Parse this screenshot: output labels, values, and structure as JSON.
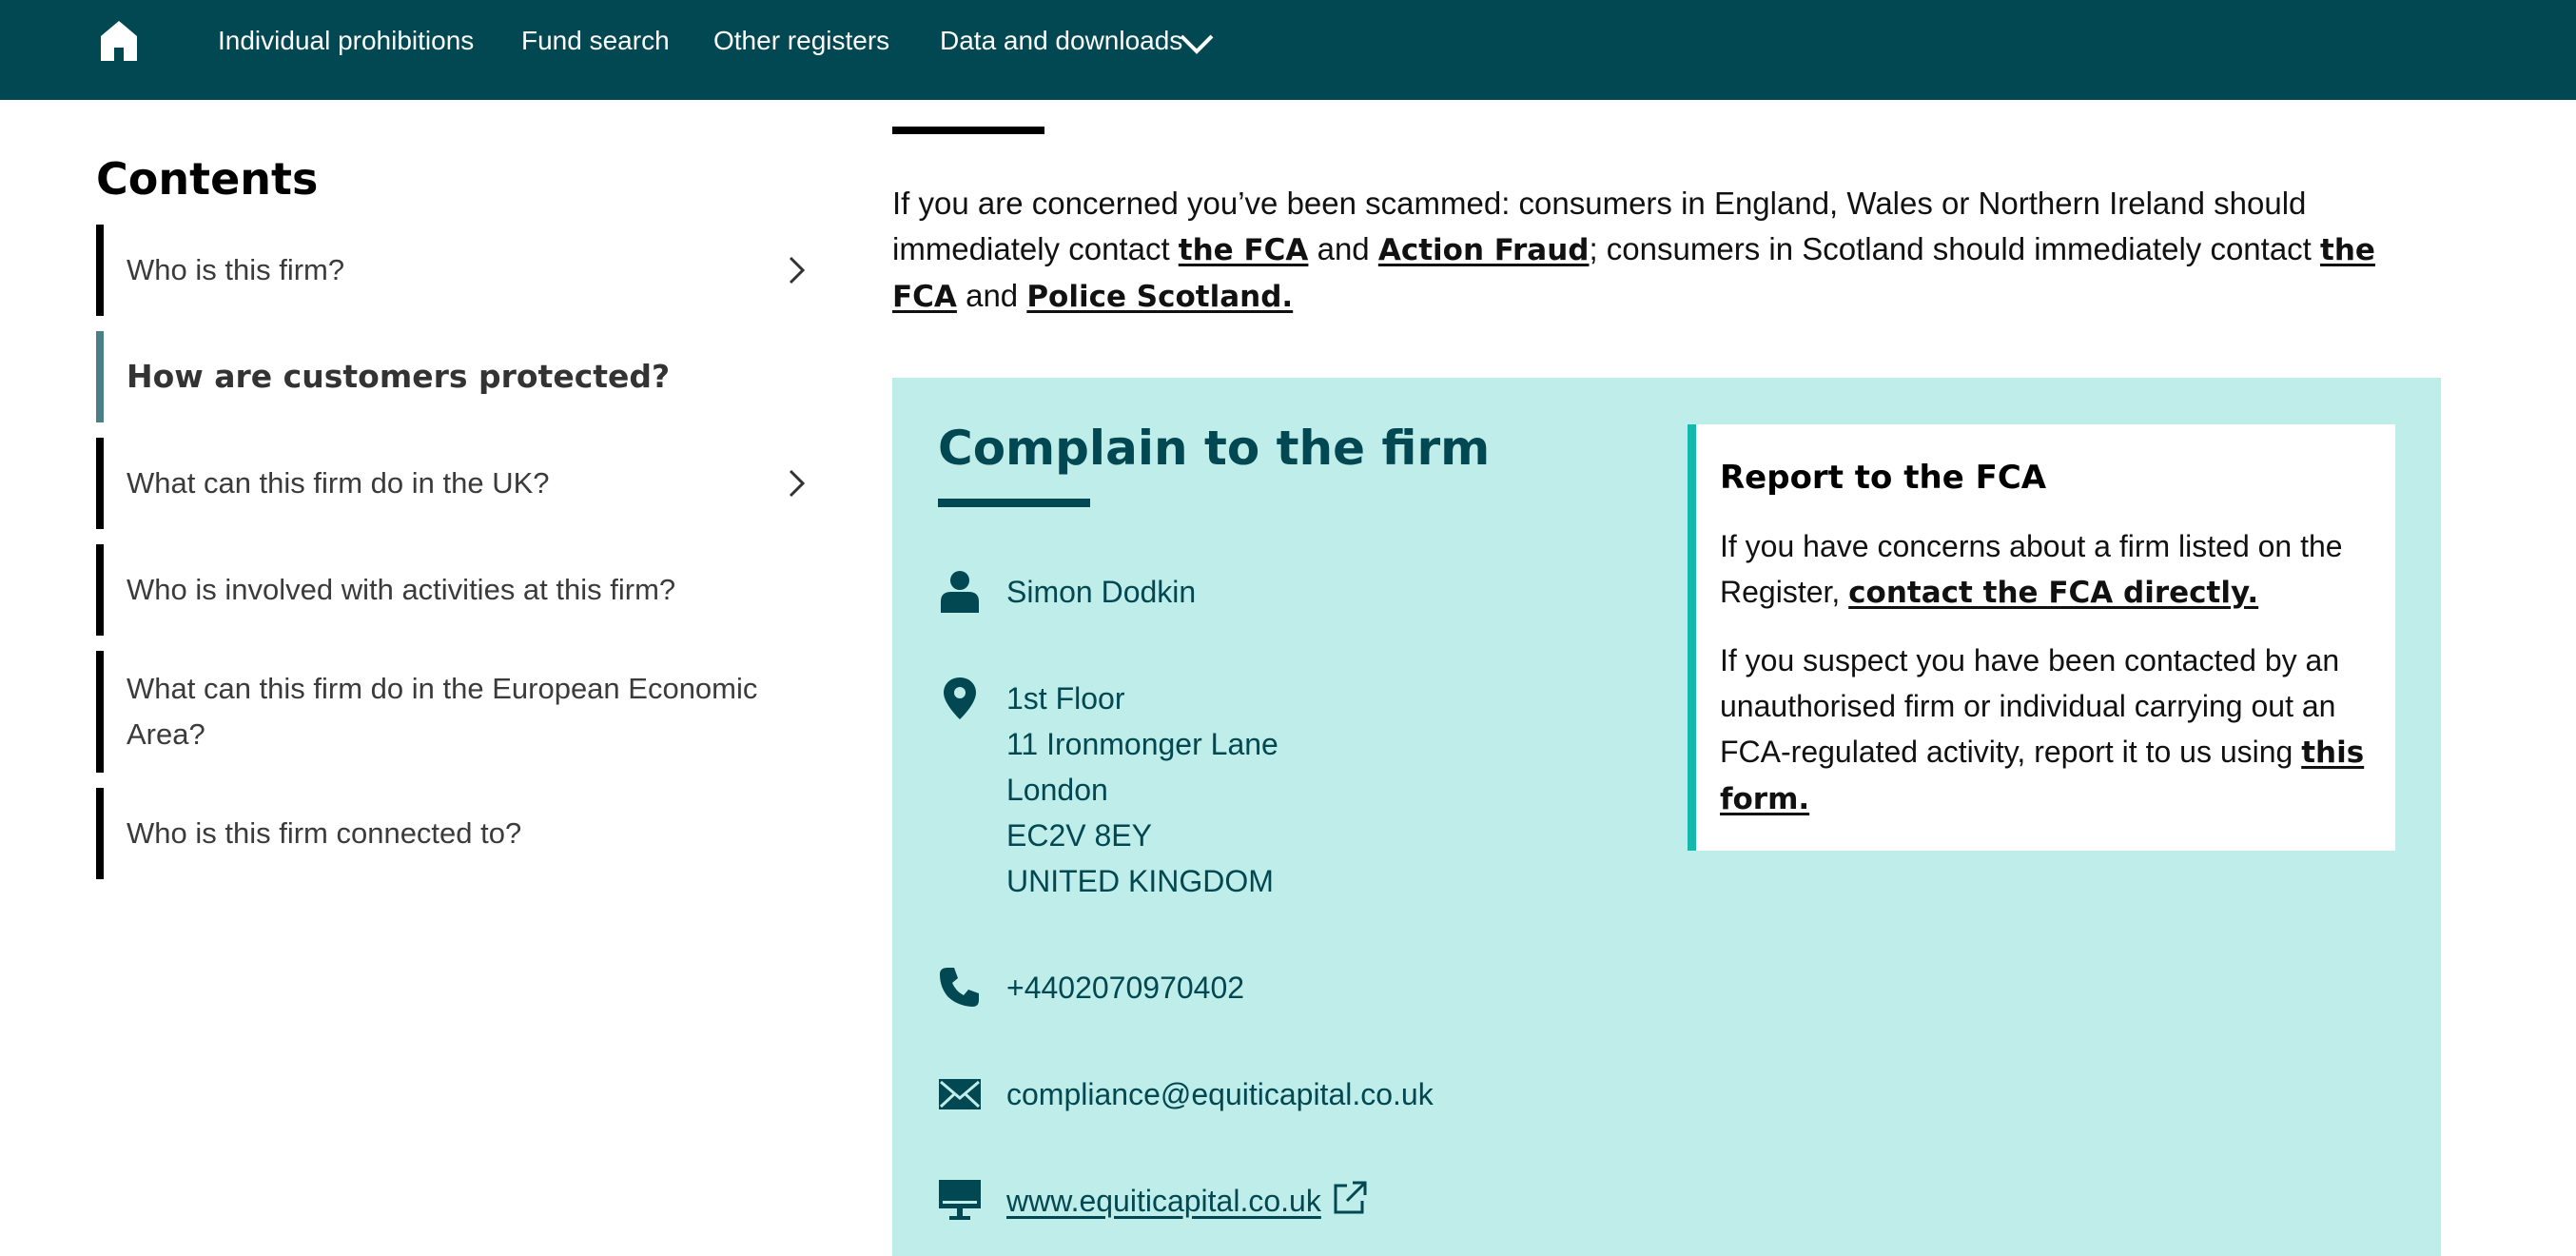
{
  "nav": {
    "home_icon": "home-icon",
    "links": [
      "Individual prohibitions",
      "Fund search",
      "Other registers",
      "Data and downloads"
    ],
    "dropdown_icon": "chevron-down-icon",
    "background": "#024852"
  },
  "sidebar": {
    "title": "Contents",
    "items": [
      {
        "label": "Who is this firm?",
        "expandable": true,
        "active": false
      },
      {
        "label": "How are customers protected?",
        "expandable": false,
        "active": true
      },
      {
        "label": "What can this firm do in the UK?",
        "expandable": true,
        "active": false
      },
      {
        "label": "Who is involved with activities at this firm?",
        "expandable": false,
        "active": false
      },
      {
        "label": "What can this firm do in the European Economic Area?",
        "expandable": false,
        "active": false
      },
      {
        "label": "Who is this firm connected to?",
        "expandable": false,
        "active": false
      }
    ],
    "active_color": "#4b7f87"
  },
  "scam_notice": {
    "part1": "If you are concerned you’ve been scammed: consumers in England, Wales or Northern Ireland should immediately contact ",
    "link1": "the FCA",
    "and1": " and ",
    "link2": "Action Fraud",
    "part2": "; consumers in Scotland should immediately contact ",
    "link3": "the FCA",
    "and2": " and ",
    "link4": "Police Scotland."
  },
  "complain": {
    "title": "Complain to the firm",
    "contact_name": "Simon Dodkin",
    "address_lines": [
      "1st Floor",
      "11 Ironmonger Lane",
      "London",
      "EC2V 8EY",
      "UNITED KINGDOM"
    ],
    "phone": "+4402070970402",
    "email": "compliance@equiticapital.co.uk",
    "website": "www.equiticapital.co.uk",
    "icons": [
      "person-icon",
      "location-pin-icon",
      "phone-icon",
      "envelope-icon",
      "computer-icon",
      "external-link-icon"
    ],
    "background": "#bfede9",
    "text_color": "#024852"
  },
  "report": {
    "title": "Report to the FCA",
    "p1_text": "If you have concerns about a firm listed on the Register, ",
    "p1_link": "contact the FCA directly.",
    "p2_text": "If you suspect you have been contacted by an unauthorised firm or individual carrying out an FCA-regulated activity, report it to us using ",
    "p2_link": "this form.",
    "accent": "#14b8ad"
  }
}
